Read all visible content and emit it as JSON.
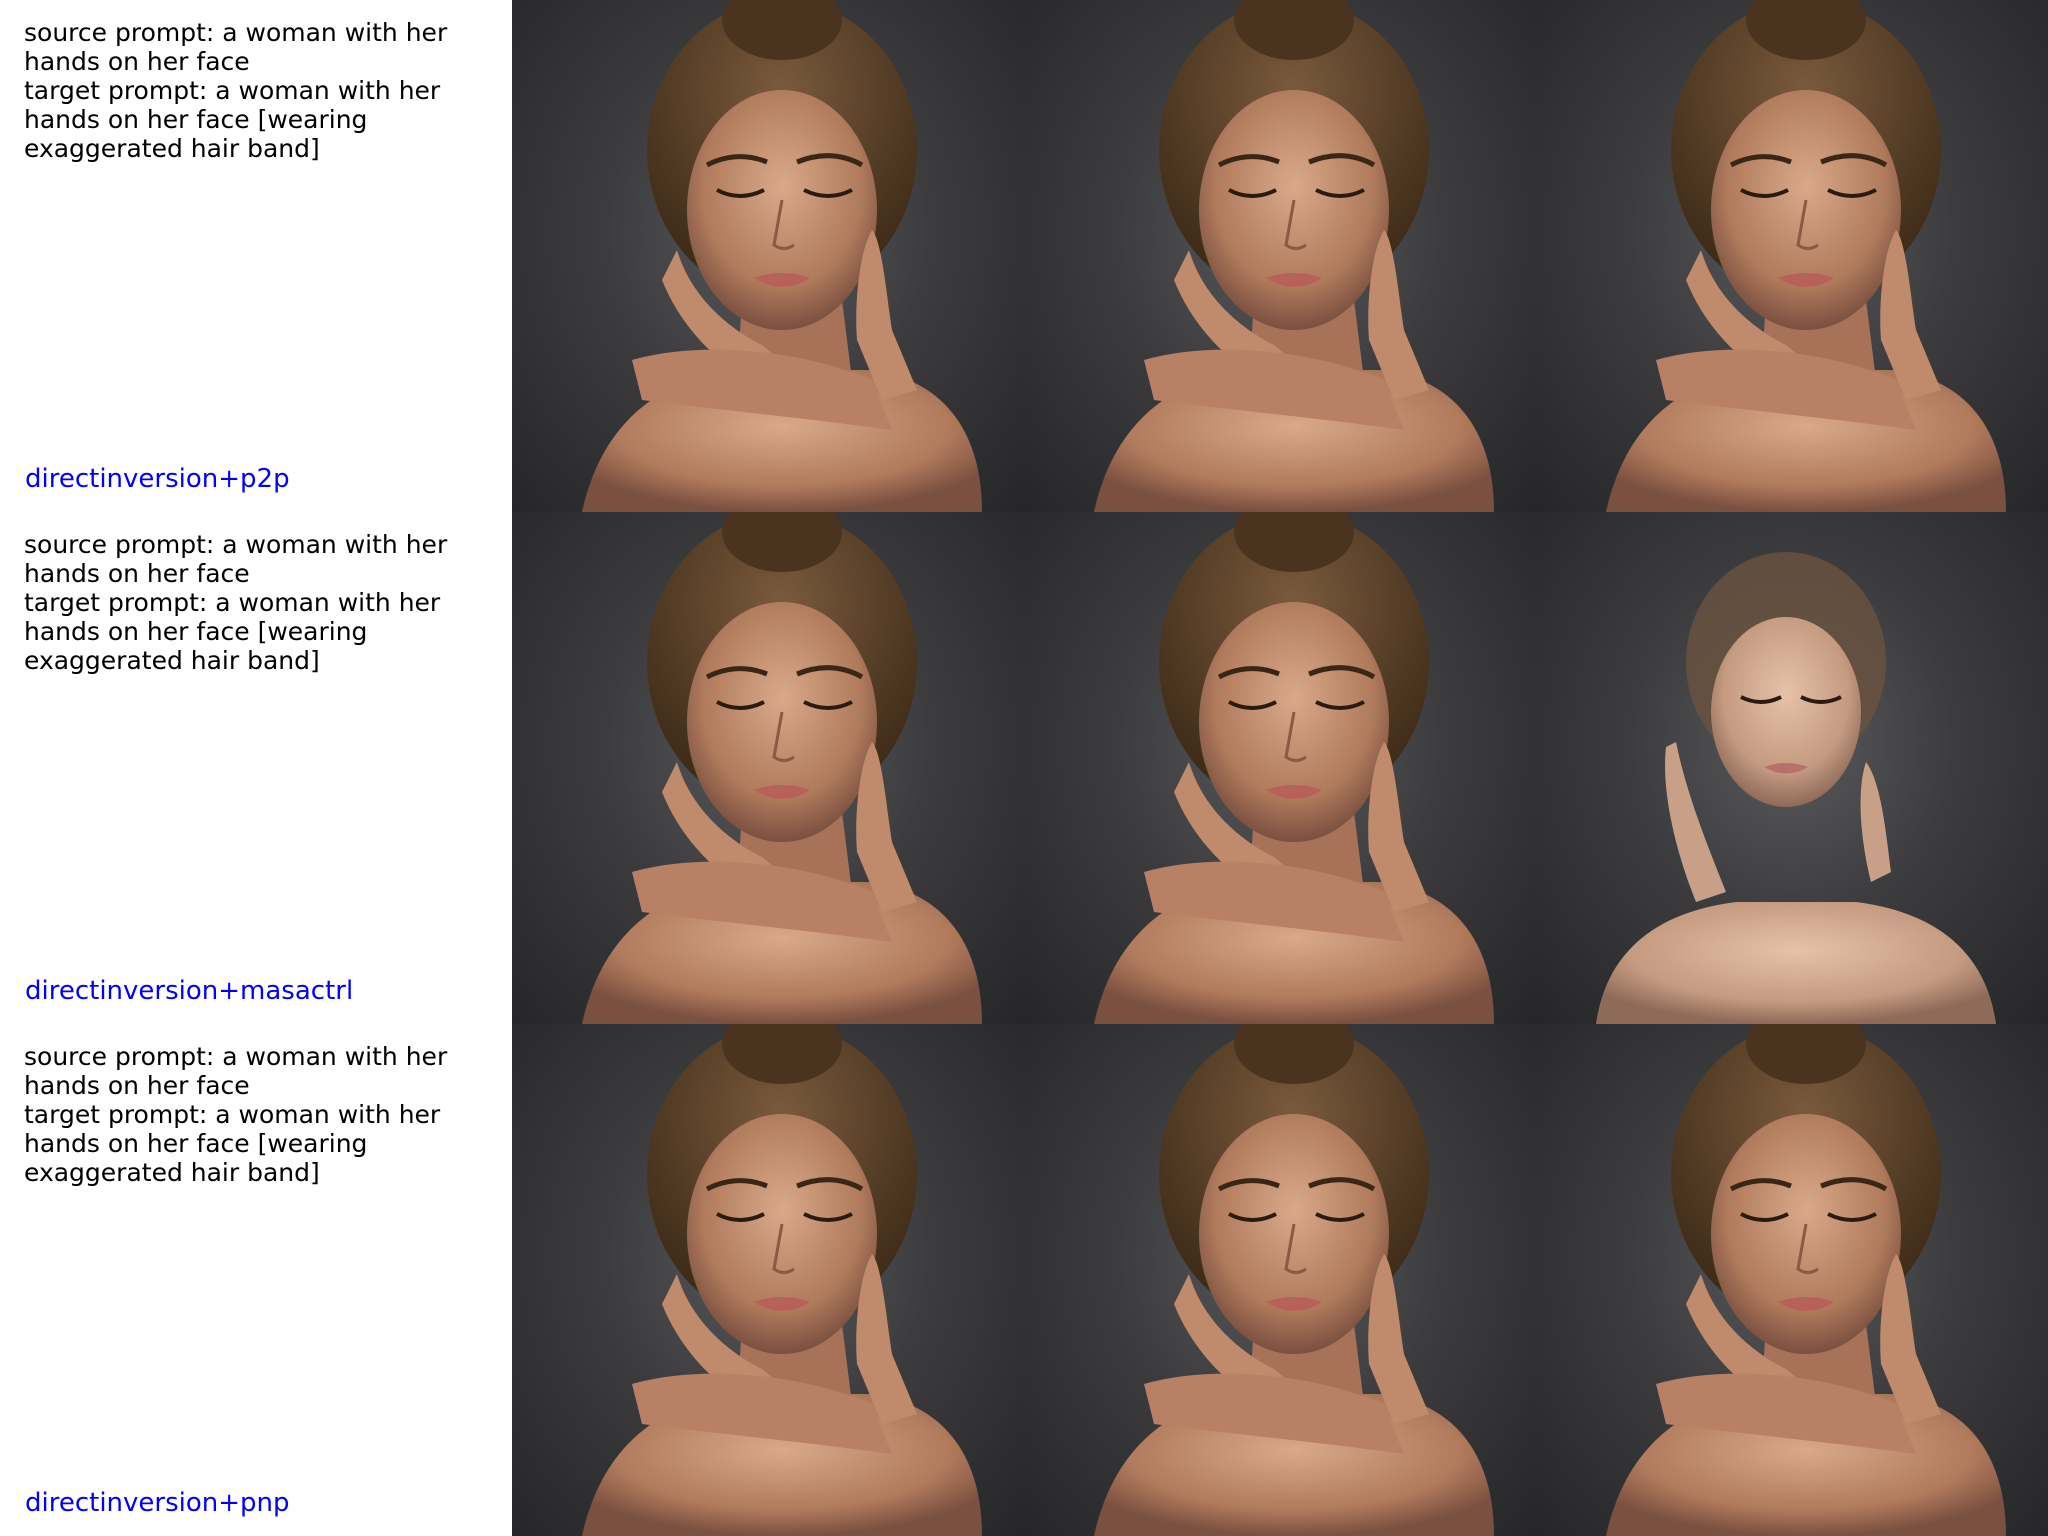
{
  "rows": [
    {
      "source_prompt": "source prompt: a woman with her hands on her face",
      "target_prompt": "target prompt: a woman with her hands on her face [wearing exaggerated hair band]",
      "method": "directinversion+p2p"
    },
    {
      "source_prompt": "source prompt: a woman with her hands on her face",
      "target_prompt": "target prompt: a woman with her hands on her face [wearing exaggerated hair band]",
      "method": "directinversion+masactrl"
    },
    {
      "source_prompt": "source prompt: a woman with her hands on her face",
      "target_prompt": "target prompt: a woman with her hands on her face [wearing exaggerated hair band]",
      "method": "directinversion+pnp"
    }
  ],
  "colors": {
    "method_label": "#0000ff",
    "prompt_text": "#000000",
    "background": "#ffffff"
  }
}
